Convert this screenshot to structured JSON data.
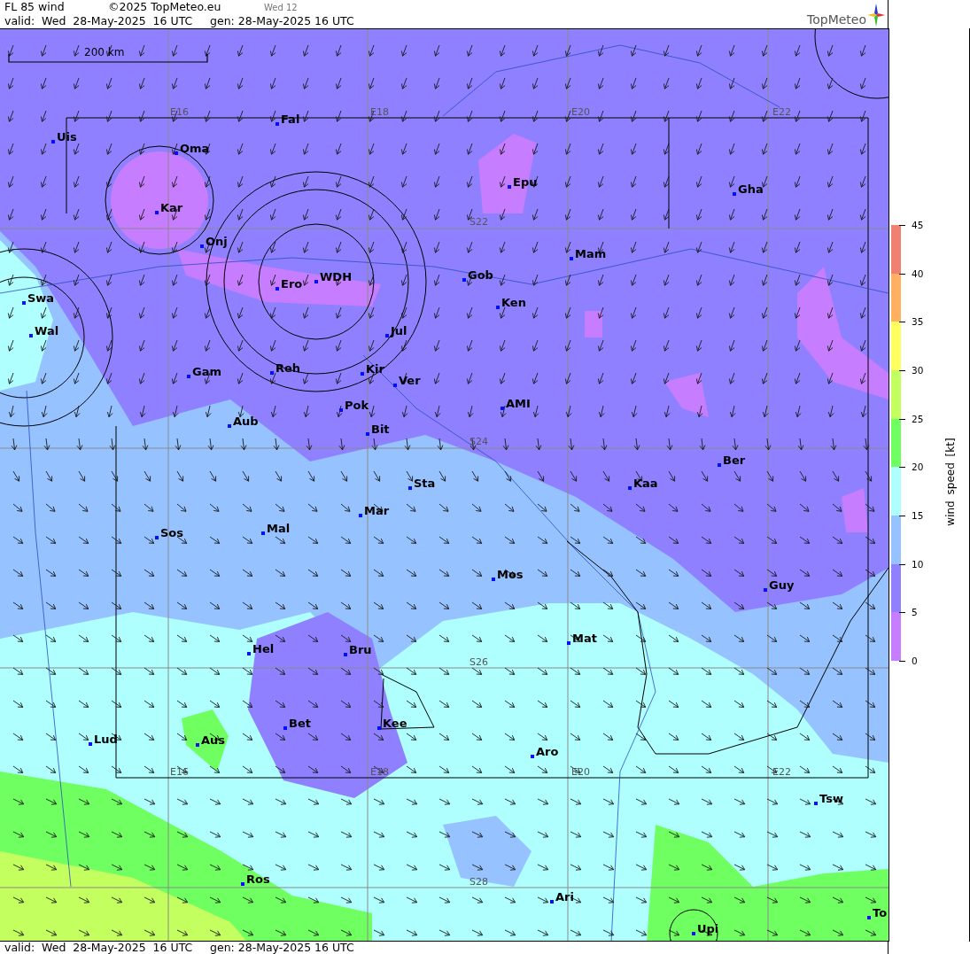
{
  "header": {
    "title": "FL 85 wind",
    "copyright": "©2025 TopMeteo.eu",
    "day": "Wed 12",
    "valid": "valid:  Wed  28-May-2025  16 UTC",
    "generated": "gen: 28-May-2025 16 UTC",
    "logo": "TopMeteo"
  },
  "map": {
    "scale": "200 km",
    "grid_labels": [
      "E16",
      "E18",
      "E20",
      "E22",
      "S22",
      "S24",
      "S26",
      "S28",
      "E16",
      "E18",
      "E20",
      "E22"
    ],
    "places": [
      "Uis",
      "Oma",
      "Fal",
      "Kar",
      "Onj",
      "Epu",
      "Gha",
      "Mam",
      "Gob",
      "Ken",
      "Swa",
      "Wal",
      "Ero",
      "WDH",
      "Jul",
      "Gam",
      "Reh",
      "Kir",
      "Ver",
      "AMI",
      "Pok",
      "Bit",
      "Aub",
      "Ber",
      "Kaa",
      "Sta",
      "Mar",
      "Sos",
      "Mal",
      "Mos",
      "Guy",
      "Mat",
      "Hel",
      "Bru",
      "Bet",
      "Kee",
      "Aus",
      "Lud",
      "Aro",
      "Tsw",
      "Ros",
      "Ari",
      "Upi",
      "To"
    ]
  },
  "legend": {
    "title": "wind speed [kt]",
    "bands": [
      {
        "color": "#f08070"
      },
      {
        "color": "#ffb060"
      },
      {
        "color": "#ffff60"
      },
      {
        "color": "#c4ff60"
      },
      {
        "color": "#70ff60"
      },
      {
        "color": "#b0ffff"
      },
      {
        "color": "#96c3ff"
      },
      {
        "color": "#8f80ff"
      },
      {
        "color": "#c77dff"
      }
    ],
    "ticks": [
      "45",
      "40",
      "35",
      "30",
      "25",
      "20",
      "15",
      "10",
      "5",
      "0"
    ]
  },
  "footer": {
    "valid": "valid:  Wed  28-May-2025  16 UTC",
    "generated": "gen: 28-May-2025 16 UTC"
  }
}
